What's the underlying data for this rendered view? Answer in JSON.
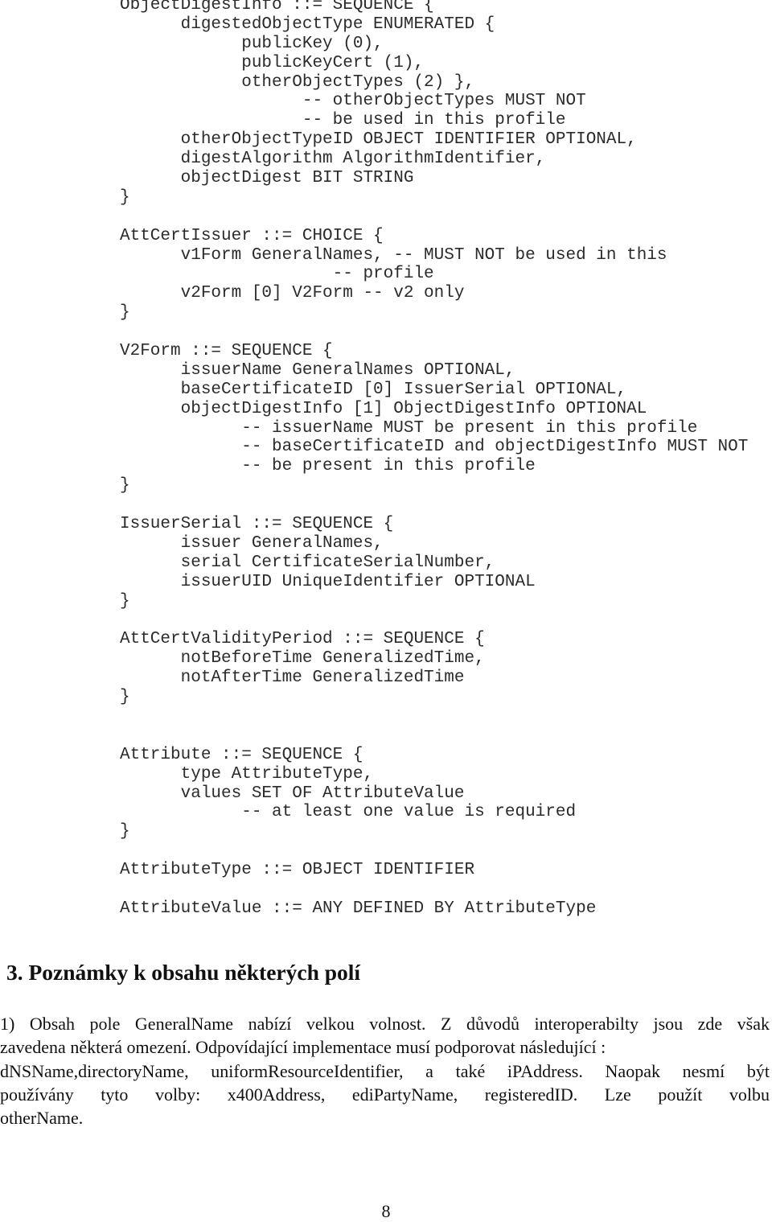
{
  "code_lines": [
    "ObjectDigestInfo ::= SEQUENCE {",
    "      digestedObjectType ENUMERATED {",
    "            publicKey (0),",
    "            publicKeyCert (1),",
    "            otherObjectTypes (2) },",
    "                  -- otherObjectTypes MUST NOT",
    "                  -- be used in this profile",
    "      otherObjectTypeID OBJECT IDENTIFIER OPTIONAL,",
    "      digestAlgorithm AlgorithmIdentifier,",
    "      objectDigest BIT STRING",
    "}",
    "",
    "AttCertIssuer ::= CHOICE {",
    "      v1Form GeneralNames, -- MUST NOT be used in this",
    "                     -- profile",
    "      v2Form [0] V2Form -- v2 only",
    "}",
    "",
    "V2Form ::= SEQUENCE {",
    "      issuerName GeneralNames OPTIONAL,",
    "      baseCertificateID [0] IssuerSerial OPTIONAL,",
    "      objectDigestInfo [1] ObjectDigestInfo OPTIONAL",
    "            -- issuerName MUST be present in this profile",
    "            -- baseCertificateID and objectDigestInfo MUST NOT",
    "            -- be present in this profile",
    "}",
    "",
    "IssuerSerial ::= SEQUENCE {",
    "      issuer GeneralNames,",
    "      serial CertificateSerialNumber,",
    "      issuerUID UniqueIdentifier OPTIONAL",
    "}",
    "",
    "AttCertValidityPeriod ::= SEQUENCE {",
    "      notBeforeTime GeneralizedTime,",
    "      notAfterTime GeneralizedTime",
    "}",
    "",
    "",
    "Attribute ::= SEQUENCE {",
    "      type AttributeType,",
    "      values SET OF AttributeValue",
    "            -- at least one value is required",
    "}",
    "",
    "AttributeType ::= OBJECT IDENTIFIER",
    "",
    "AttributeValue ::= ANY DEFINED BY AttributeType"
  ],
  "section": {
    "heading": "3. Poznámky k obsahu některých polí",
    "paragraph_lines": [
      "1) Obsah pole GeneralName nabízí velkou volnost. Z důvodů interoperabilty jsou zde však",
      "zavedena některá omezení. Odpovídající implementace musí podporovat následující :",
      "dNSName,directoryName, uniformResourceIdentifier, a také iPAddress. Naopak nesmí být",
      "používány tyto volby: x400Address, ediPartyName, registeredID. Lze použít volbu",
      "otherName."
    ]
  },
  "page_number": "8"
}
